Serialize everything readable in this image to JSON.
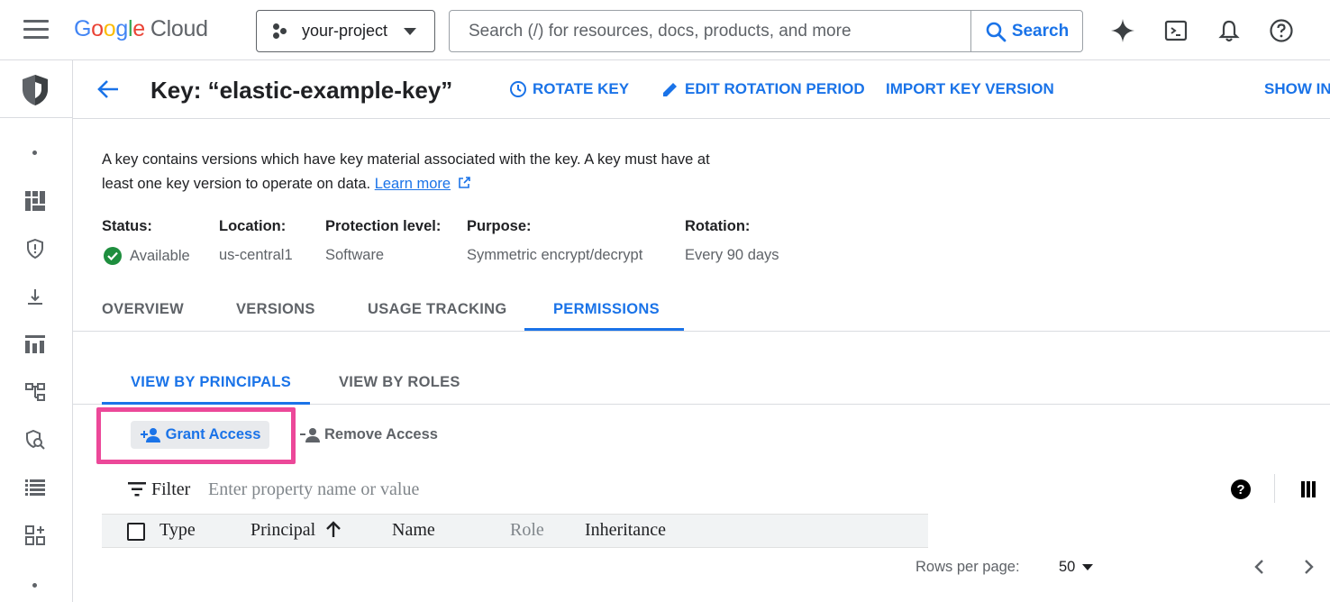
{
  "topbar": {
    "logo_letters": [
      "G",
      "o",
      "o",
      "g",
      "l",
      "e"
    ],
    "logo_product": "Cloud",
    "project": "your-project",
    "search_placeholder": "Search (/) for resources, docs, products, and more",
    "search_button": "Search",
    "icons": [
      "gemini-sparkle-icon",
      "cloud-shell-icon",
      "notifications-icon",
      "help-icon"
    ]
  },
  "rail": {
    "icons": [
      "security-shield-icon",
      "dashboard-icon",
      "shield-icon",
      "download-icon",
      "bar-chart-icon",
      "hierarchy-icon",
      "search-shield-icon",
      "list-icon",
      "grid-add-icon"
    ]
  },
  "header": {
    "title": "Key: “elastic-example-key”",
    "actions": {
      "rotate": "ROTATE KEY",
      "edit_rotation": "EDIT ROTATION PERIOD",
      "import": "IMPORT KEY VERSION",
      "show_info": "SHOW IN"
    }
  },
  "description": {
    "text": "A key contains versions which have key material associated with the key. A key must have at least one key version to operate on data. ",
    "link": "Learn more"
  },
  "meta": {
    "status_label": "Status:",
    "status_value": "Available",
    "location_label": "Location:",
    "location_value": "us-central1",
    "protection_label": "Protection level:",
    "protection_value": "Software",
    "purpose_label": "Purpose:",
    "purpose_value": "Symmetric encrypt/decrypt",
    "rotation_label": "Rotation:",
    "rotation_value": "Every 90 days"
  },
  "tabs": {
    "overview": "OVERVIEW",
    "versions": "VERSIONS",
    "usage": "USAGE TRACKING",
    "permissions": "PERMISSIONS",
    "active": "permissions"
  },
  "subtabs": {
    "principals": "VIEW BY PRINCIPALS",
    "roles": "VIEW BY ROLES",
    "active": "principals"
  },
  "actions": {
    "grant": "Grant Access",
    "remove": "Remove Access",
    "highlight_color": "#ec4899"
  },
  "filter": {
    "label": "Filter",
    "placeholder": "Enter property name or value",
    "help": "?"
  },
  "table": {
    "columns": {
      "type": "Type",
      "principal": "Principal",
      "name": "Name",
      "role": "Role",
      "inheritance": "Inheritance"
    },
    "sort_column": "Principal",
    "sort_direction": "ascending"
  },
  "pager": {
    "rows_label": "Rows per page:",
    "rows_value": "50"
  },
  "colors": {
    "accent": "#1a73e8",
    "success": "#1e8e3e"
  }
}
